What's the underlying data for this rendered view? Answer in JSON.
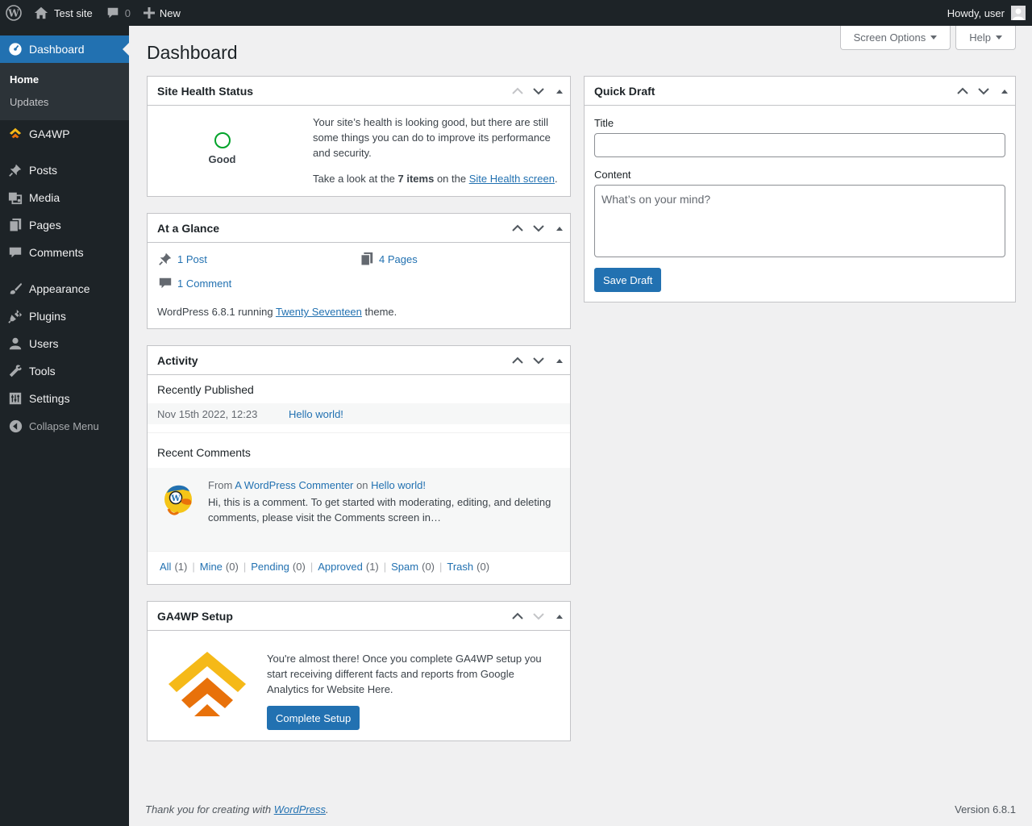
{
  "colors": {
    "admin_bar": "#1d2327",
    "accent": "#2271b1",
    "good": "#00a32a",
    "ga4wp_yellow": "#f5b918",
    "ga4wp_orange": "#e8710a"
  },
  "adminbar": {
    "site_name": "Test site",
    "comments_count": "0",
    "new_label": "New",
    "howdy": "Howdy, user"
  },
  "sidebar": {
    "dashboard": "Dashboard",
    "submenu": [
      "Home",
      "Updates"
    ],
    "items": [
      "GA4WP",
      "Posts",
      "Media",
      "Pages",
      "Comments",
      "Appearance",
      "Plugins",
      "Users",
      "Tools",
      "Settings"
    ],
    "collapse": "Collapse Menu"
  },
  "screen_meta": {
    "screen_options": "Screen Options",
    "help": "Help"
  },
  "page_title": "Dashboard",
  "site_health": {
    "title": "Site Health Status",
    "status": "Good",
    "text1": "Your site’s health is looking good, but there are still some things you can do to improve its performance and security.",
    "text2_a": "Take a look at the ",
    "text2_items": "7 items",
    "text2_b": " on the ",
    "link": "Site Health screen",
    "text2_end": "."
  },
  "glance": {
    "title": "At a Glance",
    "posts": "1 Post",
    "pages": "4 Pages",
    "comments": "1 Comment",
    "foot_a": "WordPress 6.8.1 running ",
    "theme": "Twenty Seventeen",
    "foot_b": " theme."
  },
  "activity": {
    "title": "Activity",
    "recently_published": "Recently Published",
    "post_date": "Nov 15th 2022, 12:23",
    "post_title": "Hello world!",
    "recent_comments": "Recent Comments",
    "comment_from": "From ",
    "commenter": "A WordPress Commenter",
    "comment_on": " on ",
    "comment_post": "Hello world!",
    "comment_text": "Hi, this is a comment. To get started with moderating, editing, and deleting comments, please visit the Comments screen in…",
    "filters": [
      {
        "label": "All",
        "count": "(1)"
      },
      {
        "label": "Mine",
        "count": "(0)"
      },
      {
        "label": "Pending",
        "count": "(0)"
      },
      {
        "label": "Approved",
        "count": "(1)"
      },
      {
        "label": "Spam",
        "count": "(0)"
      },
      {
        "label": "Trash",
        "count": "(0)"
      }
    ]
  },
  "ga4wp": {
    "title": "GA4WP Setup",
    "text": "You're almost there! Once you complete GA4WP setup you start receiving different facts and reports from Google Analytics for Website Here.",
    "button": "Complete Setup"
  },
  "quick_draft": {
    "title": "Quick Draft",
    "title_label": "Title",
    "content_label": "Content",
    "content_placeholder": "What’s on your mind?",
    "save": "Save Draft"
  },
  "footer": {
    "thanks_a": "Thank you for creating with ",
    "wp_link": "WordPress",
    "thanks_b": ".",
    "version": "Version 6.8.1"
  }
}
